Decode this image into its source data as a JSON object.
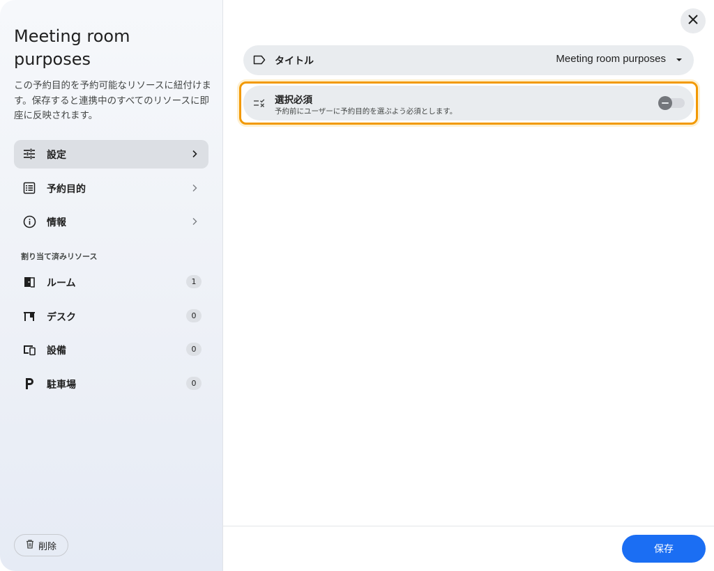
{
  "sidebar": {
    "title": "Meeting room purposes",
    "description": "この予約目的を予約可能なリソースに紐付けます。保存すると連携中のすべてのリソースに即座に反映されます。",
    "nav": [
      {
        "label": "設定",
        "icon": "tune-icon",
        "active": true
      },
      {
        "label": "予約目的",
        "icon": "list-icon",
        "active": false
      },
      {
        "label": "情報",
        "icon": "info-icon",
        "active": false
      }
    ],
    "section_label": "割り当て済みリソース",
    "resources": [
      {
        "label": "ルーム",
        "icon": "door-icon",
        "count": "1"
      },
      {
        "label": "デスク",
        "icon": "desk-icon",
        "count": "0"
      },
      {
        "label": "設備",
        "icon": "devices-icon",
        "count": "0"
      },
      {
        "label": "駐車場",
        "icon": "parking-icon",
        "count": "0"
      }
    ],
    "delete_label": "削除"
  },
  "main": {
    "title_row": {
      "label": "タイトル",
      "value": "Meeting room purposes"
    },
    "required_row": {
      "label": "選択必須",
      "sublabel": "予約前にユーザーに予約目的を選ぶよう必須とします。",
      "toggle_on": false
    },
    "save_label": "保存"
  },
  "colors": {
    "accent": "#1b6ef3",
    "highlight": "#f29900"
  }
}
